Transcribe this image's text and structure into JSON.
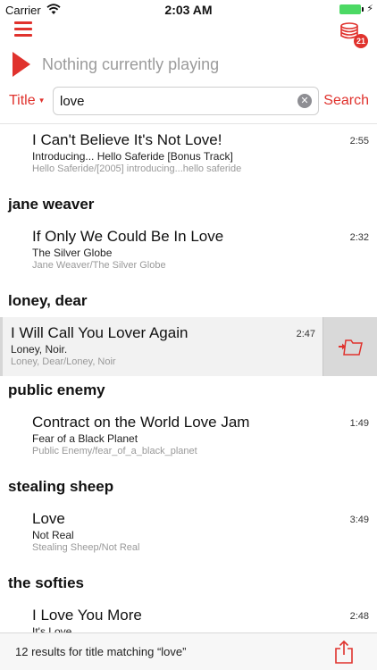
{
  "status_bar": {
    "carrier": "Carrier",
    "time": "2:03 AM"
  },
  "toolbar": {
    "queue_count": "21",
    "accent_color": "#e0322d"
  },
  "now_playing": {
    "text": "Nothing currently playing"
  },
  "search": {
    "field_label": "Title",
    "value": "love",
    "button_label": "Search"
  },
  "results": [
    {
      "type": "track",
      "title": "I Can't Believe It's Not Love!",
      "album": "Introducing... Hello Saferide [Bonus Track]",
      "path": "Hello Saferide/[2005] introducing...hello saferide",
      "duration": "2:55"
    },
    {
      "type": "header",
      "artist": "jane weaver"
    },
    {
      "type": "track",
      "title": "If Only We Could Be In Love",
      "album": "The Silver Globe",
      "path": "Jane Weaver/The Silver Globe",
      "duration": "2:32"
    },
    {
      "type": "header",
      "artist": "loney, dear"
    },
    {
      "type": "track",
      "title": "I Will Call You Lover Again",
      "album": "Loney, Noir.",
      "path": "Loney, Dear/Loney, Noir",
      "duration": "2:47",
      "swiped": true
    },
    {
      "type": "header",
      "artist": "public enemy"
    },
    {
      "type": "track",
      "title": "Contract on the World Love Jam",
      "album": "Fear of a Black Planet",
      "path": "Public Enemy/fear_of_a_black_planet",
      "duration": "1:49"
    },
    {
      "type": "header",
      "artist": "stealing sheep"
    },
    {
      "type": "track",
      "title": "Love",
      "album": "Not Real",
      "path": "Stealing Sheep/Not Real",
      "duration": "3:49"
    },
    {
      "type": "header",
      "artist": "the softies"
    },
    {
      "type": "track",
      "title": "I Love You More",
      "album": "It's Love",
      "path": "",
      "duration": "2:48"
    }
  ],
  "footer": {
    "result_count_text": "12 results for title matching “love”"
  }
}
